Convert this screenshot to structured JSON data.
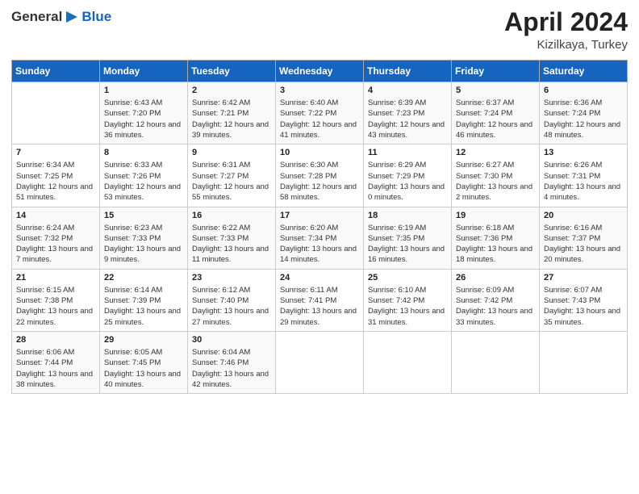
{
  "header": {
    "logo_general": "General",
    "logo_blue": "Blue",
    "title": "April 2024",
    "subtitle": "Kizilkaya, Turkey"
  },
  "columns": [
    "Sunday",
    "Monday",
    "Tuesday",
    "Wednesday",
    "Thursday",
    "Friday",
    "Saturday"
  ],
  "weeks": [
    [
      {
        "date": "",
        "sunrise": "",
        "sunset": "",
        "daylight": ""
      },
      {
        "date": "1",
        "sunrise": "Sunrise: 6:43 AM",
        "sunset": "Sunset: 7:20 PM",
        "daylight": "Daylight: 12 hours and 36 minutes."
      },
      {
        "date": "2",
        "sunrise": "Sunrise: 6:42 AM",
        "sunset": "Sunset: 7:21 PM",
        "daylight": "Daylight: 12 hours and 39 minutes."
      },
      {
        "date": "3",
        "sunrise": "Sunrise: 6:40 AM",
        "sunset": "Sunset: 7:22 PM",
        "daylight": "Daylight: 12 hours and 41 minutes."
      },
      {
        "date": "4",
        "sunrise": "Sunrise: 6:39 AM",
        "sunset": "Sunset: 7:23 PM",
        "daylight": "Daylight: 12 hours and 43 minutes."
      },
      {
        "date": "5",
        "sunrise": "Sunrise: 6:37 AM",
        "sunset": "Sunset: 7:24 PM",
        "daylight": "Daylight: 12 hours and 46 minutes."
      },
      {
        "date": "6",
        "sunrise": "Sunrise: 6:36 AM",
        "sunset": "Sunset: 7:24 PM",
        "daylight": "Daylight: 12 hours and 48 minutes."
      }
    ],
    [
      {
        "date": "7",
        "sunrise": "Sunrise: 6:34 AM",
        "sunset": "Sunset: 7:25 PM",
        "daylight": "Daylight: 12 hours and 51 minutes."
      },
      {
        "date": "8",
        "sunrise": "Sunrise: 6:33 AM",
        "sunset": "Sunset: 7:26 PM",
        "daylight": "Daylight: 12 hours and 53 minutes."
      },
      {
        "date": "9",
        "sunrise": "Sunrise: 6:31 AM",
        "sunset": "Sunset: 7:27 PM",
        "daylight": "Daylight: 12 hours and 55 minutes."
      },
      {
        "date": "10",
        "sunrise": "Sunrise: 6:30 AM",
        "sunset": "Sunset: 7:28 PM",
        "daylight": "Daylight: 12 hours and 58 minutes."
      },
      {
        "date": "11",
        "sunrise": "Sunrise: 6:29 AM",
        "sunset": "Sunset: 7:29 PM",
        "daylight": "Daylight: 13 hours and 0 minutes."
      },
      {
        "date": "12",
        "sunrise": "Sunrise: 6:27 AM",
        "sunset": "Sunset: 7:30 PM",
        "daylight": "Daylight: 13 hours and 2 minutes."
      },
      {
        "date": "13",
        "sunrise": "Sunrise: 6:26 AM",
        "sunset": "Sunset: 7:31 PM",
        "daylight": "Daylight: 13 hours and 4 minutes."
      }
    ],
    [
      {
        "date": "14",
        "sunrise": "Sunrise: 6:24 AM",
        "sunset": "Sunset: 7:32 PM",
        "daylight": "Daylight: 13 hours and 7 minutes."
      },
      {
        "date": "15",
        "sunrise": "Sunrise: 6:23 AM",
        "sunset": "Sunset: 7:33 PM",
        "daylight": "Daylight: 13 hours and 9 minutes."
      },
      {
        "date": "16",
        "sunrise": "Sunrise: 6:22 AM",
        "sunset": "Sunset: 7:33 PM",
        "daylight": "Daylight: 13 hours and 11 minutes."
      },
      {
        "date": "17",
        "sunrise": "Sunrise: 6:20 AM",
        "sunset": "Sunset: 7:34 PM",
        "daylight": "Daylight: 13 hours and 14 minutes."
      },
      {
        "date": "18",
        "sunrise": "Sunrise: 6:19 AM",
        "sunset": "Sunset: 7:35 PM",
        "daylight": "Daylight: 13 hours and 16 minutes."
      },
      {
        "date": "19",
        "sunrise": "Sunrise: 6:18 AM",
        "sunset": "Sunset: 7:36 PM",
        "daylight": "Daylight: 13 hours and 18 minutes."
      },
      {
        "date": "20",
        "sunrise": "Sunrise: 6:16 AM",
        "sunset": "Sunset: 7:37 PM",
        "daylight": "Daylight: 13 hours and 20 minutes."
      }
    ],
    [
      {
        "date": "21",
        "sunrise": "Sunrise: 6:15 AM",
        "sunset": "Sunset: 7:38 PM",
        "daylight": "Daylight: 13 hours and 22 minutes."
      },
      {
        "date": "22",
        "sunrise": "Sunrise: 6:14 AM",
        "sunset": "Sunset: 7:39 PM",
        "daylight": "Daylight: 13 hours and 25 minutes."
      },
      {
        "date": "23",
        "sunrise": "Sunrise: 6:12 AM",
        "sunset": "Sunset: 7:40 PM",
        "daylight": "Daylight: 13 hours and 27 minutes."
      },
      {
        "date": "24",
        "sunrise": "Sunrise: 6:11 AM",
        "sunset": "Sunset: 7:41 PM",
        "daylight": "Daylight: 13 hours and 29 minutes."
      },
      {
        "date": "25",
        "sunrise": "Sunrise: 6:10 AM",
        "sunset": "Sunset: 7:42 PM",
        "daylight": "Daylight: 13 hours and 31 minutes."
      },
      {
        "date": "26",
        "sunrise": "Sunrise: 6:09 AM",
        "sunset": "Sunset: 7:42 PM",
        "daylight": "Daylight: 13 hours and 33 minutes."
      },
      {
        "date": "27",
        "sunrise": "Sunrise: 6:07 AM",
        "sunset": "Sunset: 7:43 PM",
        "daylight": "Daylight: 13 hours and 35 minutes."
      }
    ],
    [
      {
        "date": "28",
        "sunrise": "Sunrise: 6:06 AM",
        "sunset": "Sunset: 7:44 PM",
        "daylight": "Daylight: 13 hours and 38 minutes."
      },
      {
        "date": "29",
        "sunrise": "Sunrise: 6:05 AM",
        "sunset": "Sunset: 7:45 PM",
        "daylight": "Daylight: 13 hours and 40 minutes."
      },
      {
        "date": "30",
        "sunrise": "Sunrise: 6:04 AM",
        "sunset": "Sunset: 7:46 PM",
        "daylight": "Daylight: 13 hours and 42 minutes."
      },
      {
        "date": "",
        "sunrise": "",
        "sunset": "",
        "daylight": ""
      },
      {
        "date": "",
        "sunrise": "",
        "sunset": "",
        "daylight": ""
      },
      {
        "date": "",
        "sunrise": "",
        "sunset": "",
        "daylight": ""
      },
      {
        "date": "",
        "sunrise": "",
        "sunset": "",
        "daylight": ""
      }
    ]
  ]
}
